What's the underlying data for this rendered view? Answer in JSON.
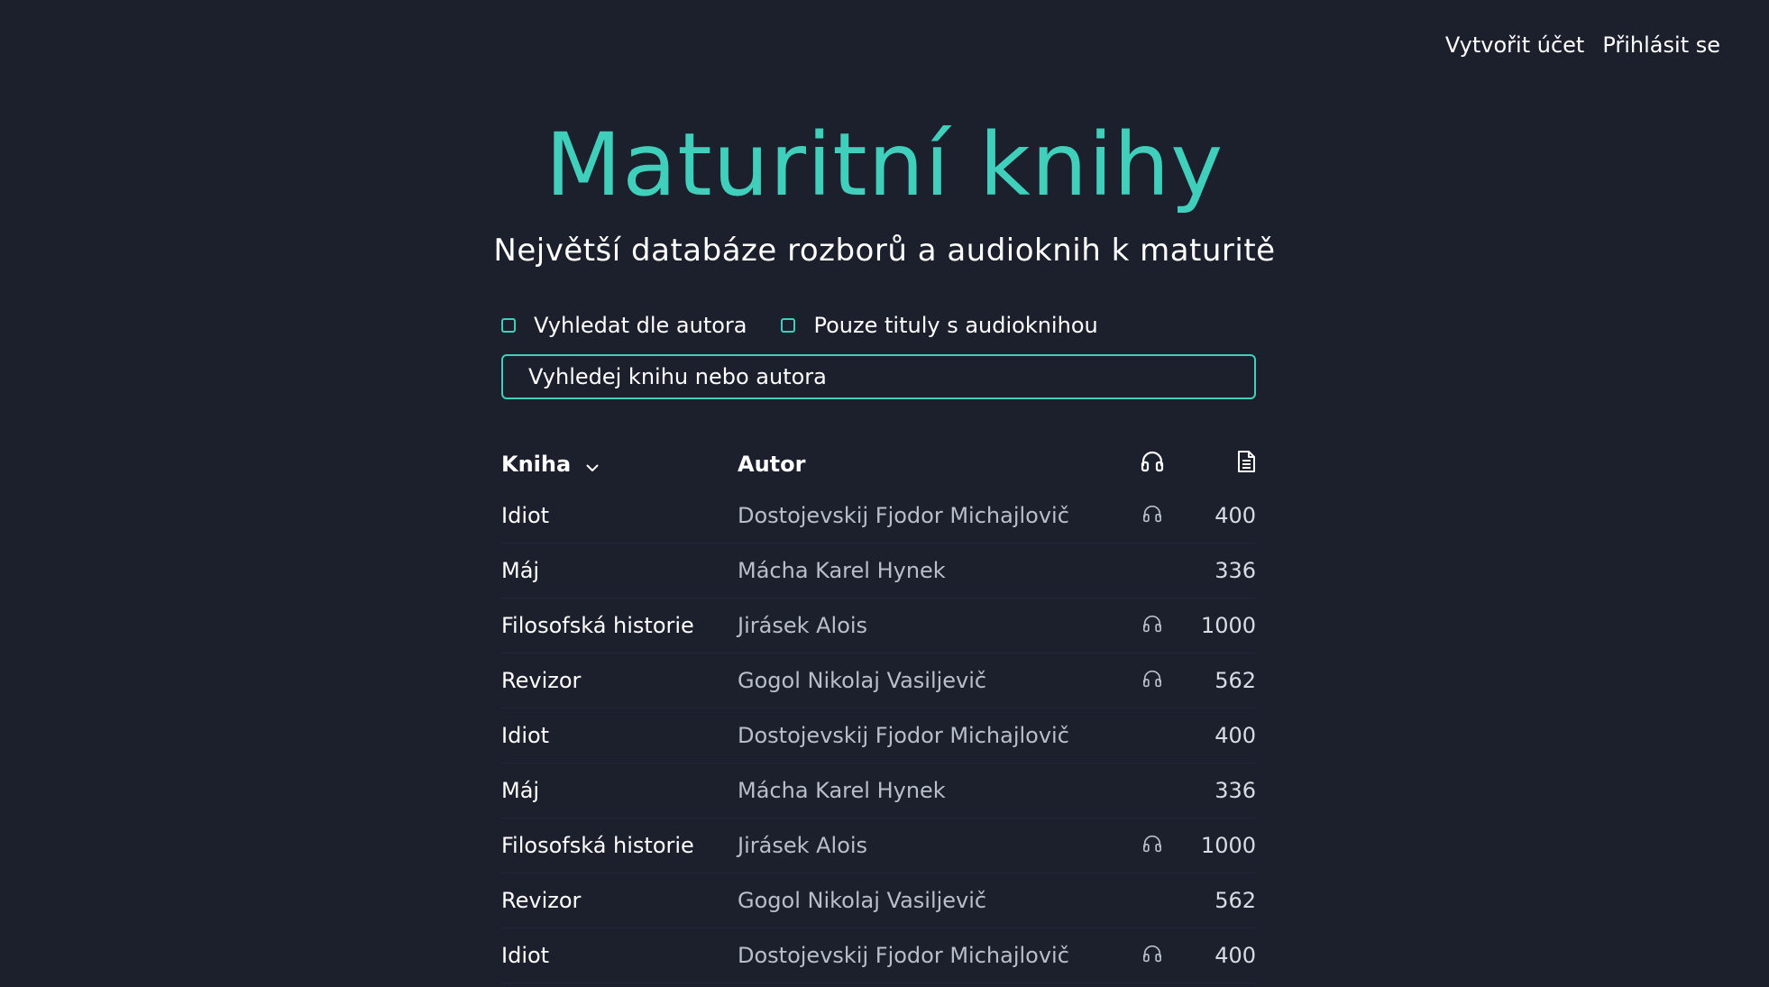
{
  "topnav": {
    "create_account": "Vytvořit účet",
    "login": "Přihlásit se"
  },
  "hero": {
    "title": "Maturitní knihy",
    "subtitle": "Největší databáze rozborů a audioknih k maturitě"
  },
  "filters": {
    "by_author": "Vyhledat dle autora",
    "audio_only": "Pouze tituly s audioknihou"
  },
  "search": {
    "placeholder": "Vyhledej knihu nebo autora"
  },
  "table": {
    "headers": {
      "book": "Kniha",
      "author": "Autor",
      "audio_icon": "headphones-icon",
      "pages_icon": "document-icon"
    },
    "rows": [
      {
        "book": "Idiot",
        "author": "Dostojevskij Fjodor Michajlovič",
        "audio": true,
        "pages": "400"
      },
      {
        "book": "Máj",
        "author": "Mácha Karel Hynek",
        "audio": false,
        "pages": "336"
      },
      {
        "book": "Filosofská historie",
        "author": "Jirásek Alois",
        "audio": true,
        "pages": "1000"
      },
      {
        "book": "Revizor",
        "author": "Gogol Nikolaj Vasiljevič",
        "audio": true,
        "pages": "562"
      },
      {
        "book": "Idiot",
        "author": "Dostojevskij Fjodor Michajlovič",
        "audio": false,
        "pages": "400"
      },
      {
        "book": "Máj",
        "author": "Mácha Karel Hynek",
        "audio": false,
        "pages": "336"
      },
      {
        "book": "Filosofská historie",
        "author": "Jirásek Alois",
        "audio": true,
        "pages": "1000"
      },
      {
        "book": "Revizor",
        "author": "Gogol Nikolaj Vasiljevič",
        "audio": false,
        "pages": "562"
      },
      {
        "book": "Idiot",
        "author": "Dostojevskij Fjodor Michajlovič",
        "audio": true,
        "pages": "400"
      }
    ]
  },
  "colors": {
    "background": "#1c202c",
    "accent": "#3fcfbb",
    "text": "#ffffff",
    "muted": "#b9bfc9"
  }
}
